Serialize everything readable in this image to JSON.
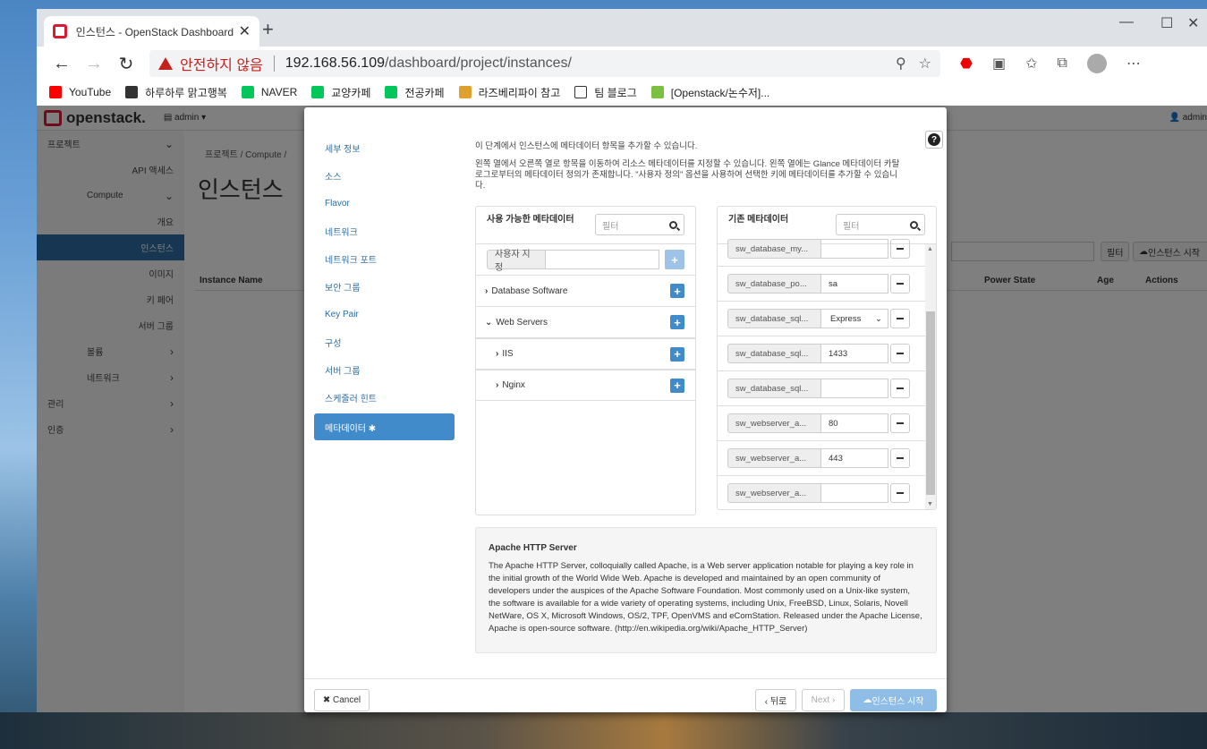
{
  "browser": {
    "tab_title": "인스턴스 - OpenStack Dashboard",
    "security_label": "안전하지 않음",
    "url_host": "192.168.56.109",
    "url_path": "/dashboard/project/instances/",
    "bookmarks": [
      {
        "label": "YouTube",
        "icon": "youtube-icon",
        "color": "#ff0000"
      },
      {
        "label": "하루하루 맑고행복",
        "icon": "tree-icon",
        "color": "#333333"
      },
      {
        "label": "NAVER",
        "icon": "naver-icon",
        "color": "#03c75a"
      },
      {
        "label": "교양카페",
        "icon": "cafe-icon",
        "color": "#03c75a"
      },
      {
        "label": "전공카페",
        "icon": "cafe-icon",
        "color": "#03c75a"
      },
      {
        "label": "라즈베리파이 참고",
        "icon": "avatar-icon",
        "color": "#e0a030"
      },
      {
        "label": "팀 블로그",
        "icon": "page-icon",
        "color": "#ffffff"
      },
      {
        "label": "[Openstack/논수저]...",
        "icon": "blog-icon",
        "color": "#7ac142"
      }
    ]
  },
  "dashboard": {
    "logo": "openstack.",
    "project_menu": "admin",
    "user_menu": "admin",
    "sidebar": [
      {
        "label": "프로젝트",
        "chev": "⌄",
        "align": "left"
      },
      {
        "label": "API 액세스",
        "chev": "",
        "align": "right"
      },
      {
        "label": "Compute",
        "chev": "⌄",
        "align": "mid"
      },
      {
        "label": "개요",
        "chev": "",
        "align": "right"
      },
      {
        "label": "인스턴스",
        "chev": "",
        "align": "right",
        "active": true
      },
      {
        "label": "이미지",
        "chev": "",
        "align": "right"
      },
      {
        "label": "키 페어",
        "chev": "",
        "align": "right"
      },
      {
        "label": "서버 그룹",
        "chev": "",
        "align": "right"
      },
      {
        "label": "볼륨",
        "chev": "›",
        "align": "mid"
      },
      {
        "label": "네트워크",
        "chev": "›",
        "align": "mid"
      },
      {
        "label": "관리",
        "chev": "›",
        "align": "left"
      },
      {
        "label": "인증",
        "chev": "›",
        "align": "left"
      }
    ],
    "breadcrumb": "프로젝트 /   Compute /",
    "page_title": "인스턴스",
    "filter_button": "필터",
    "launch_button": "인스턴스 시작",
    "columns": [
      "Instance Name",
      "Power State",
      "Age",
      "Actions"
    ]
  },
  "modal": {
    "steps": [
      "세부 정보",
      "소스",
      "Flavor",
      "네트워크",
      "네트워크 포트",
      "보안 그룹",
      "Key Pair",
      "구성",
      "서버 그룹",
      "스케줄러 힌트",
      "메타데이터 ✱"
    ],
    "intro1": "이 단계에서 인스턴스에 메타데이터 항목을 추가할 수 있습니다.",
    "intro2": "왼쪽 열에서 오른쪽 열로 항목을 이동하여 리소스 메타데이터를 지정할 수 있습니다. 왼쪽 열에는 Glance 메타데이터 카탈로그로부터의 메타데이터 정의가 존재합니다. \"사용자 정의\" 옵션을 사용하여 선택한 키에 메타데이터를 추가할 수 있습니다.",
    "available": {
      "title": "사용 가능한 메타데이터",
      "filter_placeholder": "필터",
      "custom_label": "사용자 지정",
      "items": [
        {
          "label": "Database Software",
          "caret": "›",
          "sub": false
        },
        {
          "label": "Web Servers",
          "caret": "⌄",
          "sub": false
        },
        {
          "label": "IIS",
          "caret": "›",
          "sub": true
        },
        {
          "label": "Nginx",
          "caret": "›",
          "sub": true
        }
      ]
    },
    "existing": {
      "title": "기존 메타데이터",
      "filter_placeholder": "필터",
      "rows": [
        {
          "key": "sw_database_my...",
          "value": "",
          "type": "input"
        },
        {
          "key": "sw_database_po...",
          "value": "sa",
          "type": "input"
        },
        {
          "key": "sw_database_sql...",
          "value": "Express",
          "type": "select"
        },
        {
          "key": "sw_database_sql...",
          "value": "1433",
          "type": "input"
        },
        {
          "key": "sw_database_sql...",
          "value": "",
          "type": "input"
        },
        {
          "key": "sw_webserver_a...",
          "value": "80",
          "type": "input"
        },
        {
          "key": "sw_webserver_a...",
          "value": "443",
          "type": "input"
        },
        {
          "key": "sw_webserver_a...",
          "value": "",
          "type": "input"
        }
      ]
    },
    "description_title": "Apache HTTP Server",
    "description": "The Apache HTTP Server, colloquially called Apache, is a Web server application notable for playing a key role in the initial growth of the World Wide Web. Apache is developed and maintained by an open community of developers under the auspices of the Apache Software Foundation. Most commonly used on a Unix-like system, the software is available for a wide variety of operating systems, including Unix, FreeBSD, Linux, Solaris, Novell NetWare, OS X, Microsoft Windows, OS/2, TPF, OpenVMS and eComStation. Released under the Apache License, Apache is open-source software. (http://en.wikipedia.org/wiki/Apache_HTTP_Server)",
    "cancel": "✖ Cancel",
    "back": "‹ 뒤로",
    "next": "Next ›",
    "launch": "인스턴스 시작"
  }
}
